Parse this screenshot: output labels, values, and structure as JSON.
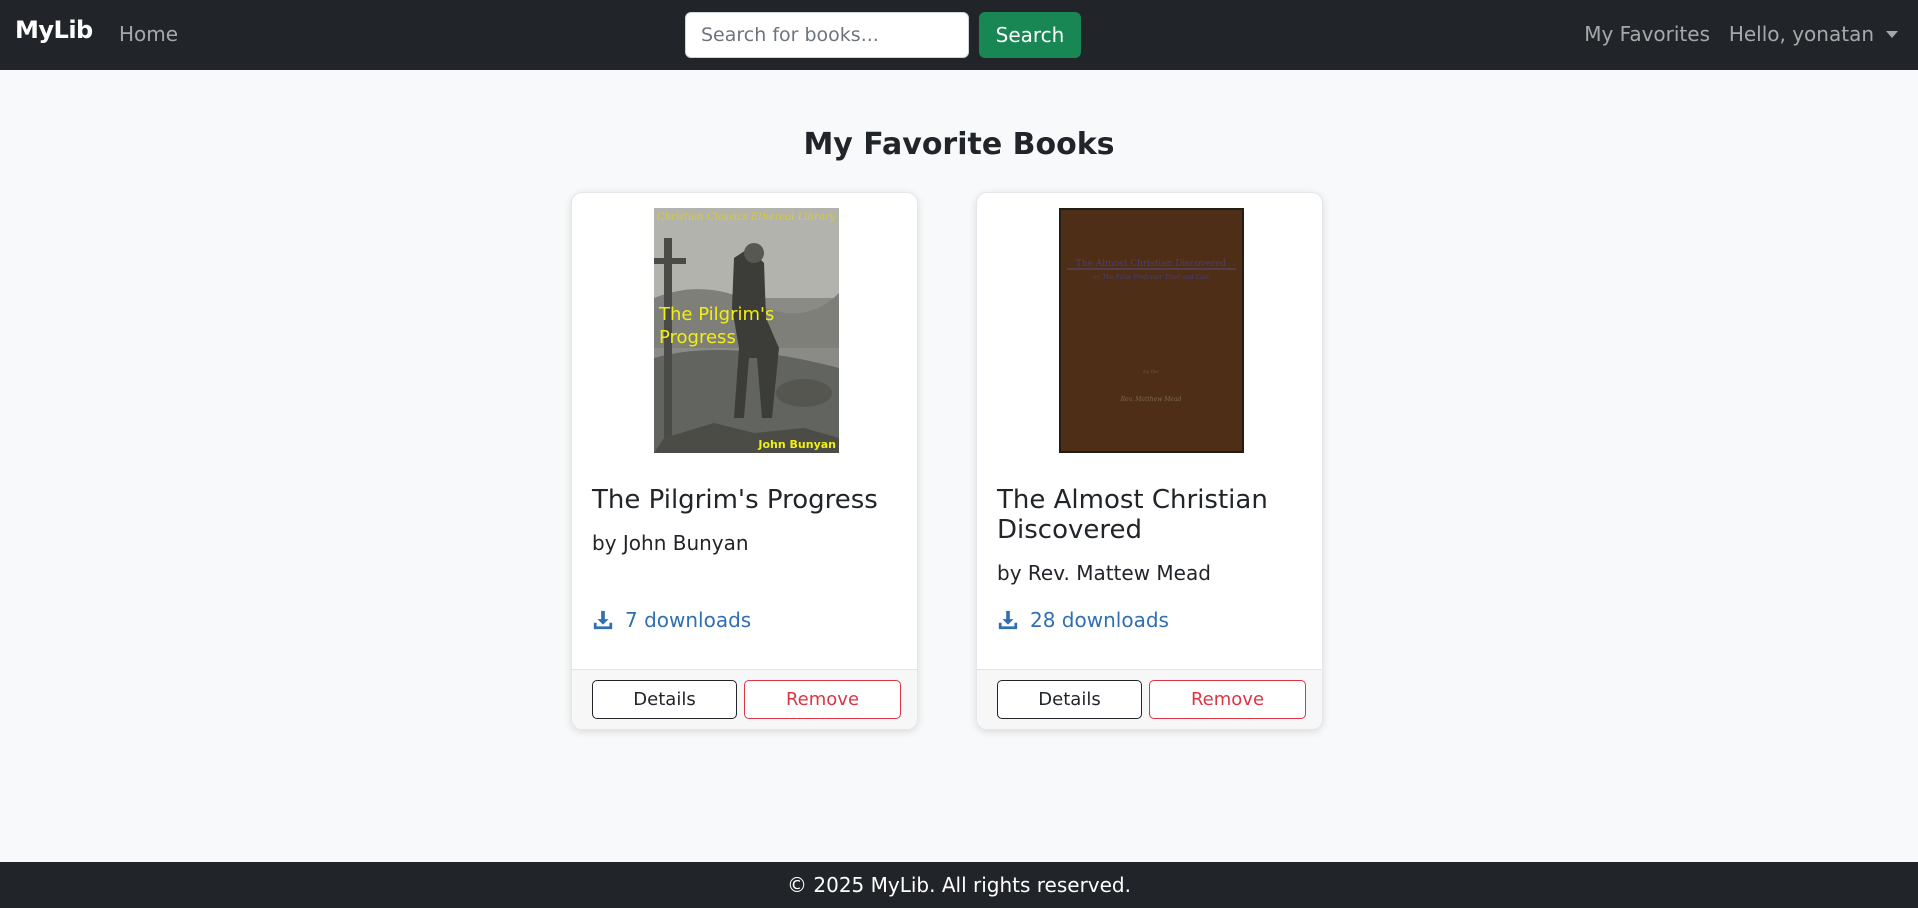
{
  "nav": {
    "brand": "MyLib",
    "home": "Home",
    "search_placeholder": "Search for books...",
    "search_button": "Search",
    "favorites": "My Favorites",
    "user_greeting": "Hello, yonatan"
  },
  "page": {
    "title": "My Favorite Books"
  },
  "books": [
    {
      "title": "The Pilgrim's Progress",
      "author": "by John Bunyan",
      "downloads": "7 downloads",
      "details_label": "Details",
      "remove_label": "Remove",
      "cover": {
        "top_text": "Christian Classics Ethereal Library",
        "title_line1": "The Pilgrim's",
        "title_line2": "Progress",
        "author_text": "John Bunyan"
      }
    },
    {
      "title": "The Almost Christian Discovered",
      "author": "by Rev. Mattew Mead",
      "downloads": "28 downloads",
      "details_label": "Details",
      "remove_label": "Remove",
      "cover": {
        "title_text": "The Almost Christian Discovered",
        "subtitle_text": "or, The False Professor Tried and Cast",
        "by_text": "by the",
        "author_text": "Rev. Matthew Mead"
      }
    }
  ],
  "footer": {
    "text": "© 2025 MyLib. All rights reserved."
  },
  "colors": {
    "navbar_bg": "#212529",
    "search_button": "#198754",
    "remove_red": "#dc3545",
    "download_blue": "#2f6fb2"
  }
}
